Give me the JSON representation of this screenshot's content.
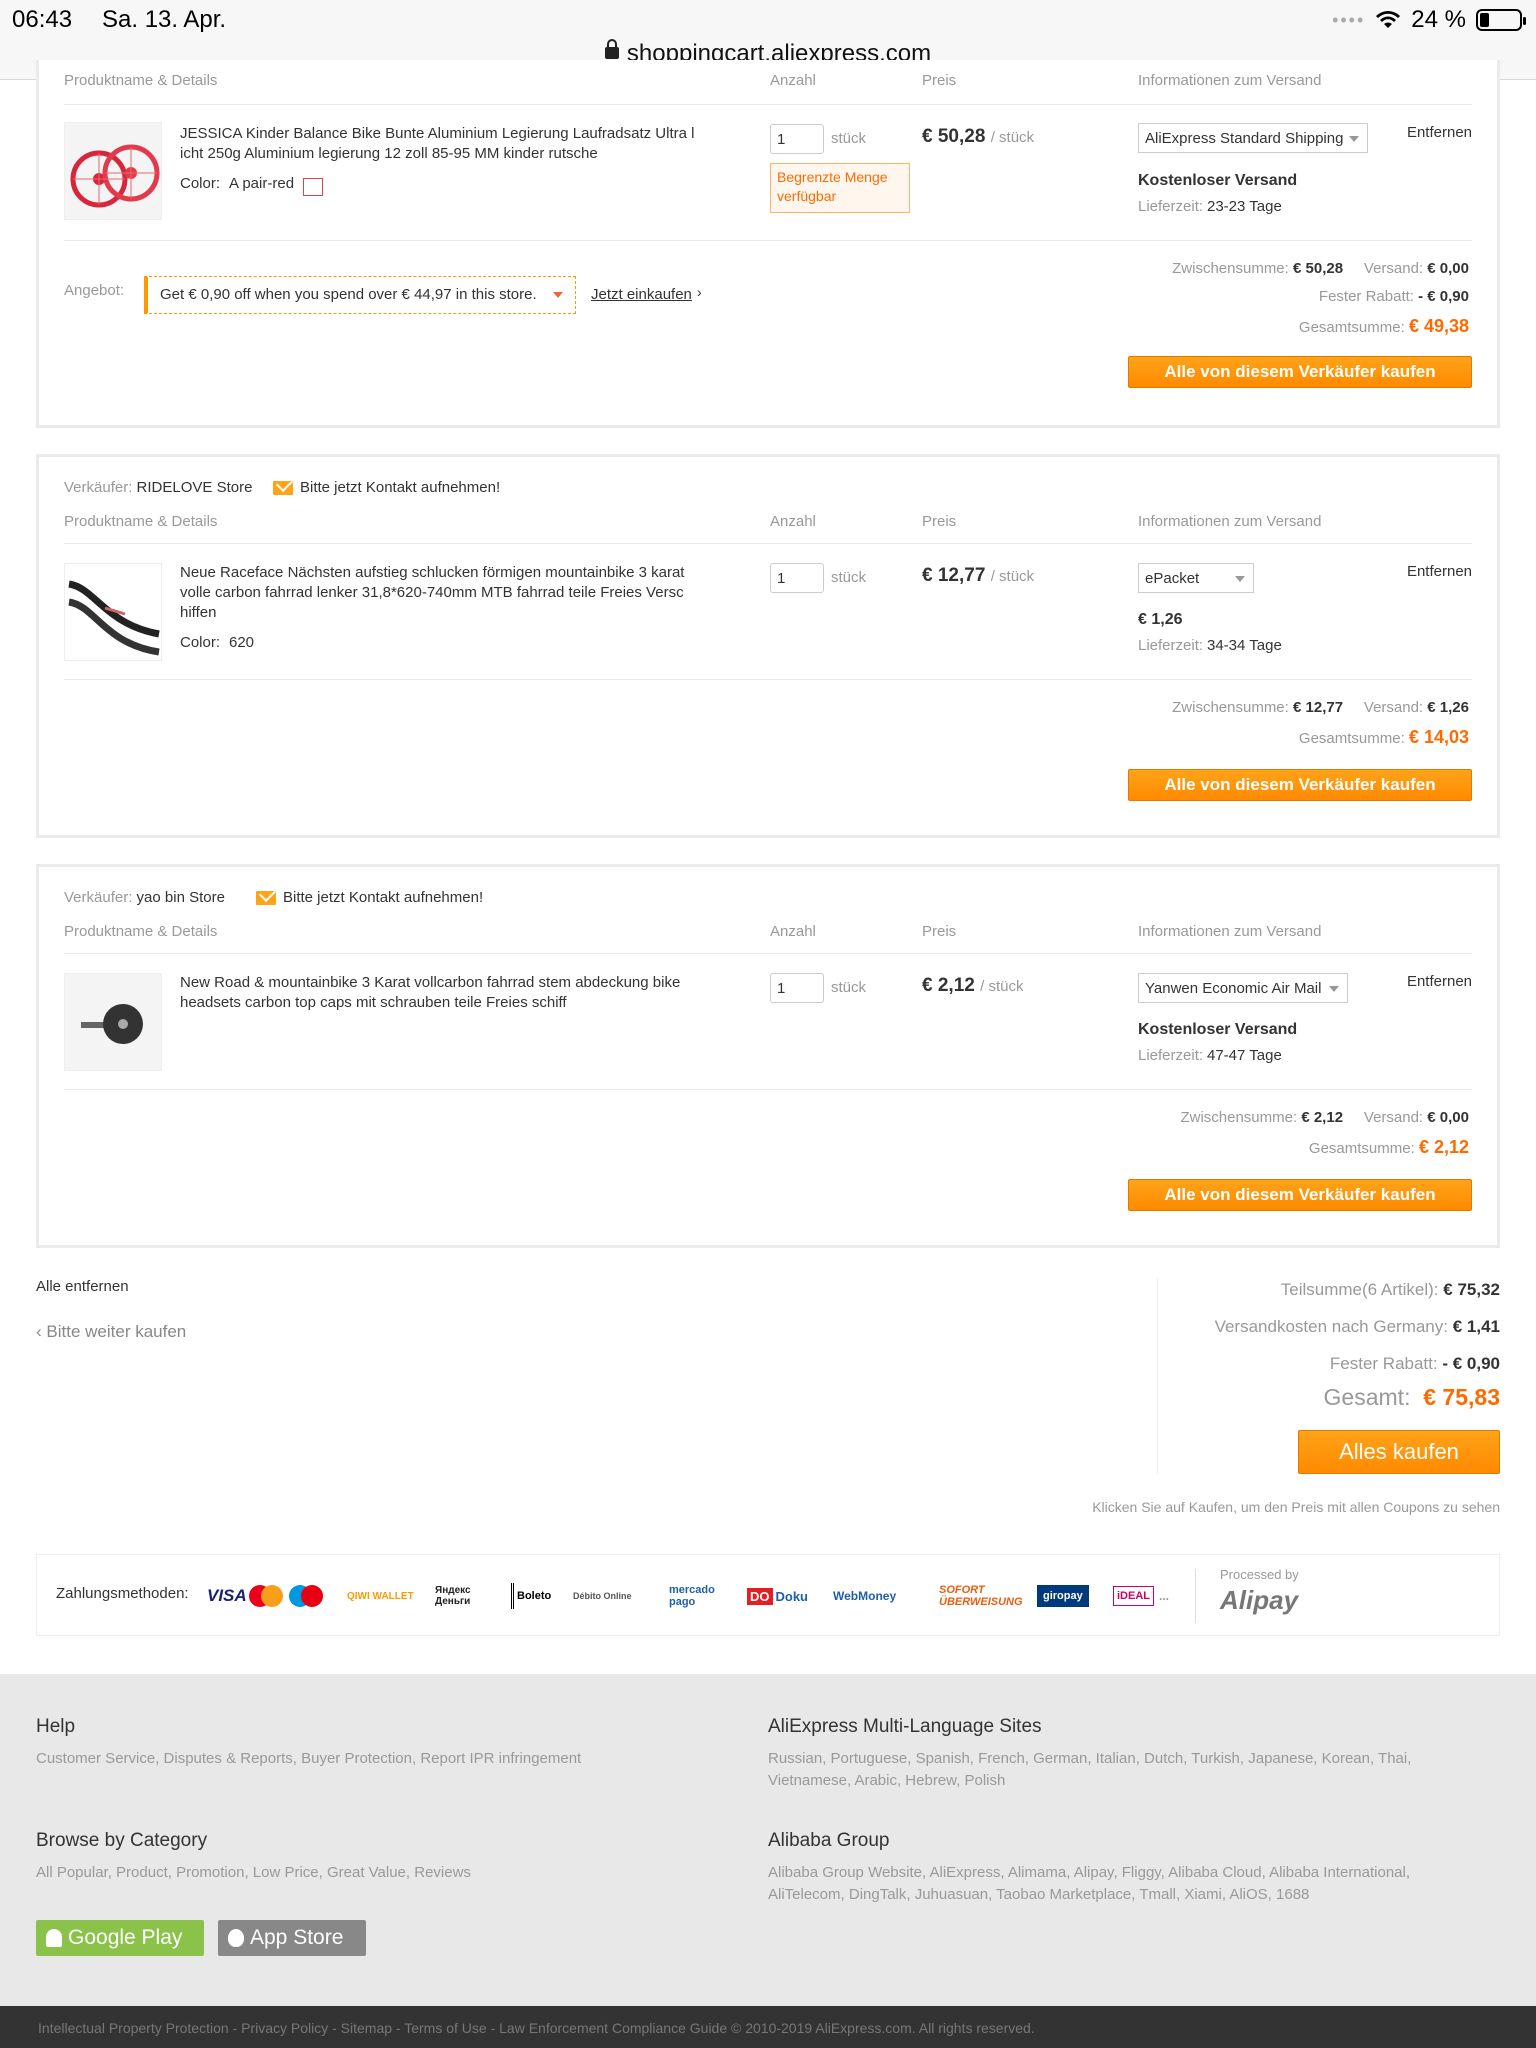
{
  "status_bar": {
    "time": "06:43",
    "date": "Sa. 13. Apr.",
    "battery": "24 %"
  },
  "url": "shoppingcart.aliexpress.com",
  "columns": {
    "product": "Produktname & Details",
    "qty": "Anzahl",
    "price": "Preis",
    "shipping": "Informationen zum Versand"
  },
  "store1": {
    "item": {
      "title": "JESSICA Kinder Balance Bike Bunte Aluminium Legierung Laufradsatz Ultra l icht 250g Aluminium legierung 12 zoll 85-95 MM kinder rutsche",
      "color_label": "Color:",
      "color_value": "A pair-red",
      "qty": "1",
      "unit": "stück",
      "limited": "Begrenzte Menge verfügbar",
      "price": "€ 50,28",
      "per": "/ stück",
      "ship_method": "AliExpress Standard Shipping",
      "ship_cost": "Kostenloser Versand",
      "delivery_label": "Lieferzeit:",
      "delivery": "23-23 Tage",
      "remove": "Entfernen"
    },
    "offer_label": "Angebot:",
    "offer_text": "Get € 0,90 off when you spend over € 44,97 in this store.",
    "offer_link": "Jetzt einkaufen",
    "subtotal_label": "Zwischensumme:",
    "subtotal": "€ 50,28",
    "shipping_label": "Versand:",
    "shipping": "€ 0,00",
    "discount_label": "Fester Rabatt:",
    "discount": "- € 0,90",
    "total_label": "Gesamtsumme:",
    "total": "€ 49,38",
    "buy_button": "Alle von diesem Verkäufer kaufen"
  },
  "store2": {
    "seller_label": "Verkäufer:",
    "seller": "RIDELOVE Store",
    "contact": "Bitte jetzt Kontakt aufnehmen!",
    "item": {
      "title": "Neue Raceface Nächsten aufstieg schlucken förmigen mountainbike 3 karat volle carbon fahrrad lenker 31,8*620-740mm MTB fahrrad teile Freies Versc hiffen",
      "color_label": "Color:",
      "color_value": "620",
      "qty": "1",
      "unit": "stück",
      "price": "€ 12,77",
      "per": "/ stück",
      "ship_method": "ePacket",
      "ship_cost": "€ 1,26",
      "delivery_label": "Lieferzeit:",
      "delivery": "34-34 Tage",
      "remove": "Entfernen"
    },
    "subtotal_label": "Zwischensumme:",
    "subtotal": "€ 12,77",
    "shipping_label": "Versand:",
    "shipping": "€ 1,26",
    "total_label": "Gesamtsumme:",
    "total": "€ 14,03",
    "buy_button": "Alle von diesem Verkäufer kaufen"
  },
  "store3": {
    "seller_label": "Verkäufer:",
    "seller": "yao bin Store",
    "contact": "Bitte jetzt Kontakt aufnehmen!",
    "item": {
      "title": "New Road & mountainbike 3 Karat vollcarbon fahrrad stem abdeckung bike headsets carbon top caps mit schrauben teile Freies schiff",
      "qty": "1",
      "unit": "stück",
      "price": "€ 2,12",
      "per": "/ stück",
      "ship_method": "Yanwen Economic Air Mail",
      "ship_cost": "Kostenloser Versand",
      "delivery_label": "Lieferzeit:",
      "delivery": "47-47 Tage",
      "remove": "Entfernen"
    },
    "subtotal_label": "Zwischensumme:",
    "subtotal": "€ 2,12",
    "shipping_label": "Versand:",
    "shipping": "€ 0,00",
    "total_label": "Gesamtsumme:",
    "total": "€ 2,12",
    "buy_button": "Alle von diesem Verkäufer kaufen"
  },
  "cart": {
    "remove_all": "Alle entfernen",
    "continue": "Bitte weiter kaufen",
    "subtotal_label": "Teilsumme(6 Artikel):",
    "subtotal": "€ 75,32",
    "shipping_label": "Versandkosten nach Germany:",
    "shipping": "€ 1,41",
    "discount_label": "Fester Rabatt:",
    "discount": "- € 0,90",
    "total_label": "Gesamt:",
    "total": "€ 75,83",
    "buy_all": "Alles kaufen",
    "hint": "Klicken Sie auf Kaufen, um den Preis mit allen Coupons zu sehen"
  },
  "payment": {
    "label": "Zahlungsmethoden:",
    "methods": [
      "VISA",
      "MasterCard",
      "Maestro",
      "QIWI WALLET",
      "Яндекс Деньги",
      "Boleto",
      "Débito Online",
      "mercado pago",
      "Doku",
      "WebMoney",
      "SOFORT ÜBERWEISUNG",
      "giropay",
      "iDEAL",
      "..."
    ],
    "processed_by": "Processed by",
    "alipay": "Alipay"
  },
  "footer": {
    "help_title": "Help",
    "help_links": "Customer Service, Disputes & Reports, Buyer Protection, Report IPR infringement",
    "lang_title": "AliExpress Multi-Language Sites",
    "lang_links": "Russian, Portuguese, Spanish, French, German, Italian, Dutch, Turkish, Japanese, Korean, Thai, Vietnamese, Arabic, Hebrew, Polish",
    "browse_title": "Browse by Category",
    "browse_links": "All Popular, Product, Promotion, Low Price, Great Value, Reviews",
    "alibaba_title": "Alibaba Group",
    "alibaba_links": "Alibaba Group Website, AliExpress, Alimama, Alipay, Fliggy, Alibaba Cloud, Alibaba International, AliTelecom, DingTalk, Juhuasuan, Taobao Marketplace, Tmall, Xiami, AliOS, 1688",
    "google_play": "Google Play",
    "app_store": "App Store",
    "bottom": "Intellectual Property Protection  -  Privacy Policy  -  Sitemap  -  Terms of Use  -  Law Enforcement Compliance Guide  © 2010-2019 AliExpress.com. All rights reserved."
  },
  "colors": {
    "accent": "#ff9900",
    "price_orange": "#ff6a00"
  }
}
